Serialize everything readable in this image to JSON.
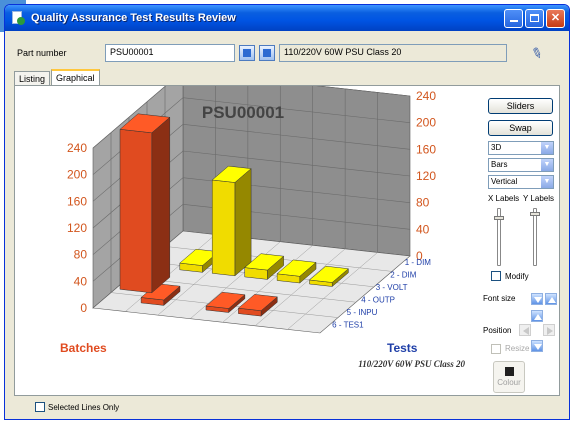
{
  "window": {
    "title": "Quality Assurance Test Results Review"
  },
  "part": {
    "label": "Part number",
    "value": "PSU00001",
    "description": "110/220V 60W PSU Class 20"
  },
  "tabs": [
    {
      "label": "Listing"
    },
    {
      "label": "Graphical"
    }
  ],
  "side_panel": {
    "sliders_button": "Sliders",
    "swap_button": "Swap",
    "view_select": "3D",
    "type_select": "Bars",
    "orientation_select": "Vertical",
    "x_labels": "X Labels",
    "y_labels": "Y Labels",
    "modify_label": "Modify",
    "font_size_label": "Font size",
    "position_label": "Position",
    "resize_label": "Resize",
    "colour_button": "Colour"
  },
  "footer": {
    "selected_lines_label": "Selected Lines Only"
  },
  "colors": {
    "batch_red": "#e04b20",
    "test_yellow": "#f0dc00",
    "tests_blue": "#1f3fa8"
  },
  "chart_data": {
    "type": "bar",
    "title": "PSU00001",
    "subtitle": "110/220V 60W PSU Class 20",
    "xlabel": "Tests",
    "ylabel": "Batches",
    "left_axis_ticks": [
      "0",
      "40",
      "80",
      "120",
      "160",
      "200",
      "240"
    ],
    "right_axis_ticks": [
      "0",
      "40",
      "80",
      "120",
      "160",
      "200",
      "240"
    ],
    "zlim": [
      0,
      240
    ],
    "categories": [
      "1 - DIM",
      "2 - DIM",
      "3 - VOLT",
      "4 - OUTP",
      "5 - INPU",
      "6 - TES1"
    ],
    "series": [
      {
        "values": [
          0,
          8,
          0,
          6,
          8,
          0
        ]
      },
      {
        "values": [
          0,
          10,
          140,
          14,
          10,
          6
        ]
      }
    ],
    "series_colors": [
      "#e04b20",
      "#f0dc00"
    ],
    "tall_bar": {
      "values": [
        240,
        120
      ],
      "series_colors": [
        "#e04b20",
        "#f0dc00"
      ]
    }
  }
}
